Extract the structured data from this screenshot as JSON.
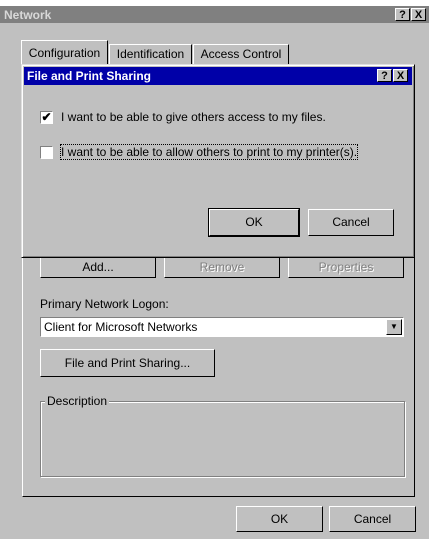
{
  "outer_window": {
    "title": "Network",
    "help_btn": "?",
    "close_btn": "X"
  },
  "tabs": [
    {
      "label": "Configuration",
      "active": true
    },
    {
      "label": "Identification",
      "active": false
    },
    {
      "label": "Access Control",
      "active": false
    }
  ],
  "components": {
    "add_label": "Add...",
    "remove_label": "Remove",
    "properties_label": "Properties"
  },
  "logon": {
    "label": "Primary Network Logon:",
    "value": "Client for Microsoft Networks"
  },
  "file_print_sharing_button": "File and Print Sharing...",
  "description": {
    "legend": "Description"
  },
  "footer": {
    "ok_label": "OK",
    "cancel_label": "Cancel"
  },
  "dialog": {
    "title": "File and Print Sharing",
    "help_btn": "?",
    "close_btn": "X",
    "option_files": {
      "label": "I want to be able to give others access to my files.",
      "checked": true
    },
    "option_printers": {
      "label": "I want to be able to allow others to print to my printer(s).",
      "checked": false
    },
    "ok_label": "OK",
    "cancel_label": "Cancel"
  }
}
